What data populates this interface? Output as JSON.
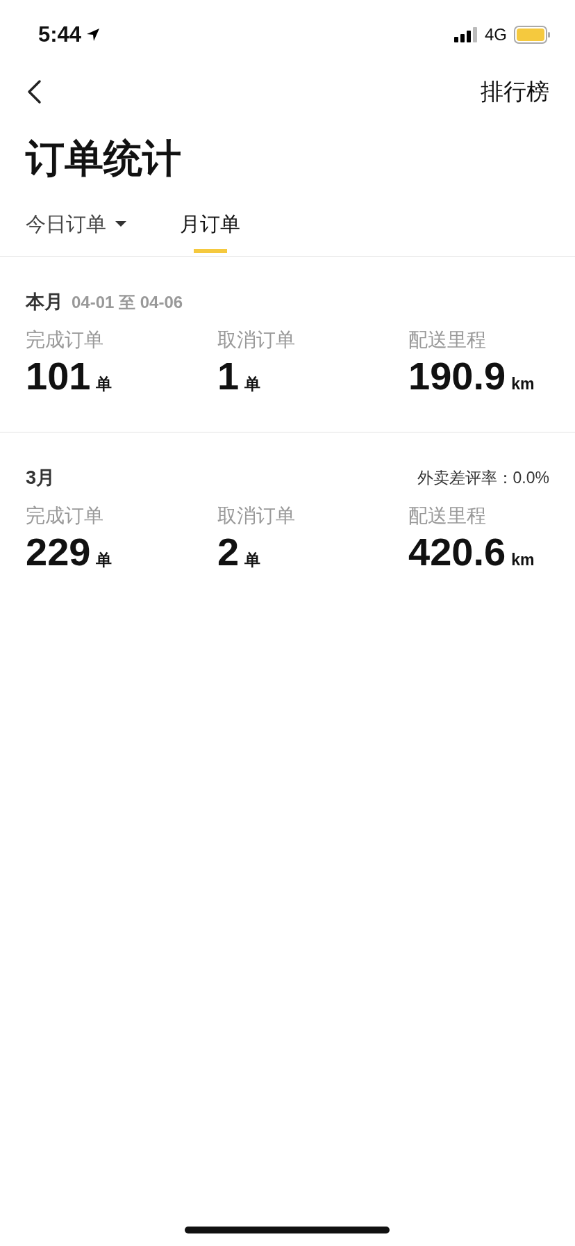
{
  "status_bar": {
    "time": "5:44",
    "network": "4G"
  },
  "nav": {
    "action": "排行榜"
  },
  "title": "订单统计",
  "tabs": [
    {
      "label": "今日订单",
      "selected": false,
      "dropdown": true
    },
    {
      "label": "月订单",
      "selected": true,
      "dropdown": false
    }
  ],
  "months": [
    {
      "title": "本月",
      "range": "04-01 至 04-06",
      "stats": [
        {
          "label": "完成订单",
          "value": "101",
          "unit": "单"
        },
        {
          "label": "取消订单",
          "value": "1",
          "unit": "单"
        },
        {
          "label": "配送里程",
          "value": "190.9",
          "unit": "km"
        }
      ]
    },
    {
      "title": "3月",
      "rating": "外卖差评率：0.0%",
      "stats": [
        {
          "label": "完成订单",
          "value": "229",
          "unit": "单"
        },
        {
          "label": "取消订单",
          "value": "2",
          "unit": "单"
        },
        {
          "label": "配送里程",
          "value": "420.6",
          "unit": "km"
        }
      ]
    }
  ]
}
